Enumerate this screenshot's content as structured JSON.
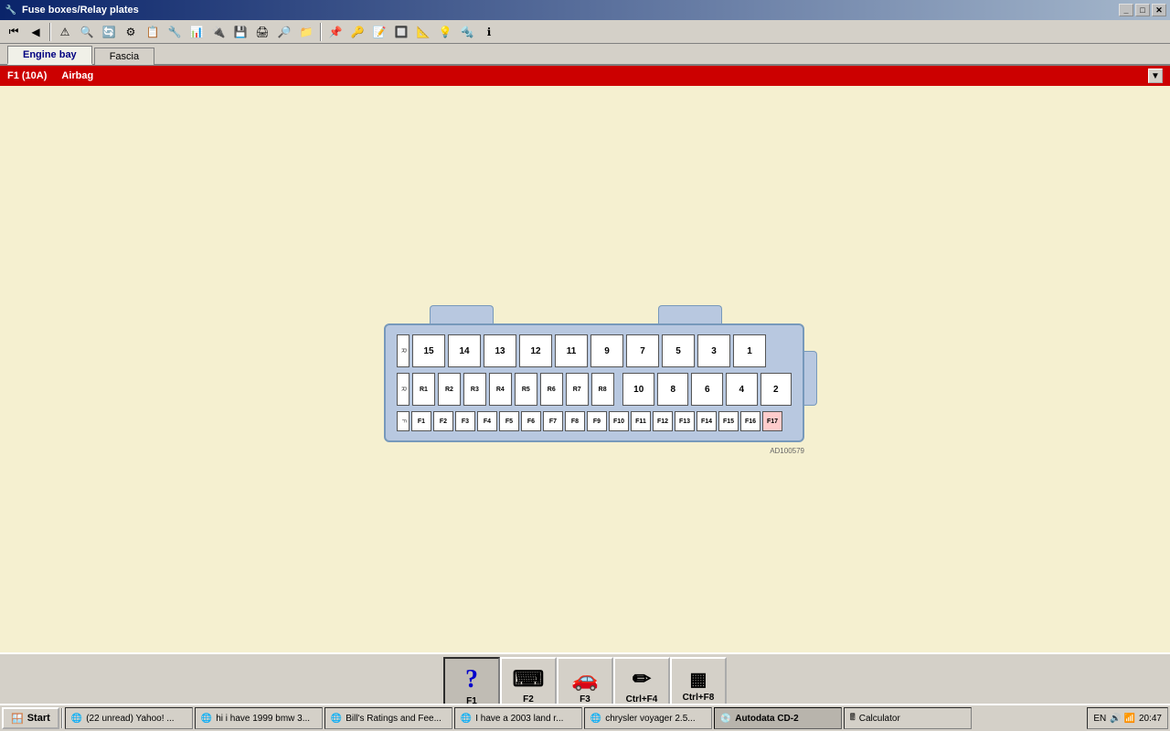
{
  "window": {
    "title": "Fuse boxes/Relay plates",
    "icon": "🔧"
  },
  "toolbar": {
    "buttons": [
      "⏮",
      "◀",
      "⚠",
      "🔍",
      "🔄",
      "⚙",
      "📋",
      "🔧",
      "📊",
      "🔌",
      "💾",
      "🖨",
      "🔎",
      "📁",
      "📌",
      "🔑",
      "📝",
      "🔲",
      "📐",
      "💡",
      "🔩",
      "ℹ"
    ]
  },
  "tabs": [
    {
      "id": "engine-bay",
      "label": "Engine bay",
      "active": true
    },
    {
      "id": "fascia",
      "label": "Fascia",
      "active": false
    }
  ],
  "fuse_bar": {
    "code": "F1 (10A)",
    "description": "Airbag"
  },
  "fuse_diagram": {
    "row1": [
      "15",
      "14",
      "13",
      "12",
      "11",
      "9",
      "7",
      "5",
      "3",
      "1"
    ],
    "row2_small": [
      "R1",
      "R2",
      "R3",
      "R4",
      "R5",
      "R6",
      "R7",
      "R8"
    ],
    "row2_large": [
      "10",
      "8",
      "6",
      "4",
      "2"
    ],
    "row3": [
      "F1",
      "F2",
      "F3",
      "F4",
      "F5",
      "F6",
      "F7",
      "F8",
      "F9",
      "F10",
      "F11",
      "F12",
      "F13",
      "F14",
      "F15",
      "F16",
      "F17"
    ],
    "watermark": "AD100579"
  },
  "bottom_buttons": [
    {
      "id": "f1",
      "label": "F1",
      "icon": "?",
      "active": true
    },
    {
      "id": "f2",
      "label": "F2",
      "icon": "⌨",
      "active": false
    },
    {
      "id": "f3",
      "label": "F3",
      "icon": "🚗",
      "active": false
    },
    {
      "id": "ctrl_f4",
      "label": "Ctrl+F4",
      "icon": "✏",
      "active": false
    },
    {
      "id": "ctrl_f8",
      "label": "Ctrl+F8",
      "icon": "🔢",
      "active": false
    }
  ],
  "taskbar": {
    "start_label": "Start",
    "items": [
      {
        "id": "yahoo",
        "label": "(22 unread) Yahoo! ...",
        "icon": "🌐",
        "active": false
      },
      {
        "id": "bmw",
        "label": "hi i have 1999 bmw 3...",
        "icon": "🌐",
        "active": false
      },
      {
        "id": "bills_ratings",
        "label": "Bill's Ratings and Fee...",
        "icon": "🌐",
        "active": false
      },
      {
        "id": "land_rover",
        "label": "I have a 2003 land r...",
        "icon": "🌐",
        "active": false
      },
      {
        "id": "chrysler",
        "label": "chrysler voyager 2.5...",
        "icon": "🌐",
        "active": false
      },
      {
        "id": "autodata",
        "label": "Autodata CD-2",
        "icon": "💿",
        "active": true
      },
      {
        "id": "calculator",
        "label": "Calculator",
        "icon": "🖩",
        "active": false
      }
    ],
    "systray": {
      "language": "EN",
      "time": "20:47"
    }
  }
}
